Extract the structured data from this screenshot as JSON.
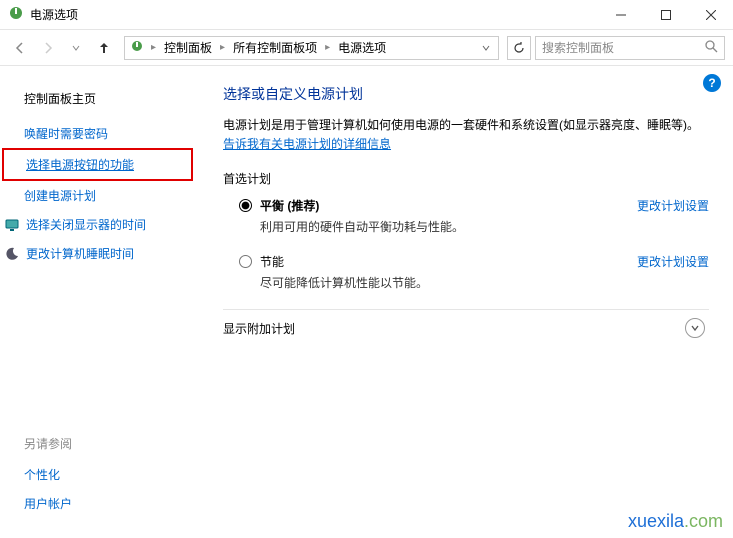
{
  "window": {
    "title": "电源选项"
  },
  "breadcrumb": {
    "items": [
      "控制面板",
      "所有控制面板项",
      "电源选项"
    ]
  },
  "search": {
    "placeholder": "搜索控制面板"
  },
  "sidebar": {
    "home": "控制面板主页",
    "links": [
      {
        "label": "唤醒时需要密码"
      },
      {
        "label": "选择电源按钮的功能",
        "highlighted": true
      },
      {
        "label": "创建电源计划"
      },
      {
        "label": "选择关闭显示器的时间",
        "icon": "monitor"
      },
      {
        "label": "更改计算机睡眠时间",
        "icon": "moon"
      }
    ],
    "seealso_label": "另请参阅",
    "seealso": [
      "个性化",
      "用户帐户"
    ]
  },
  "main": {
    "heading": "选择或自定义电源计划",
    "desc_a": "电源计划是用于管理计算机如何使用电源的一套硬件和系统设置(如显示器亮度、睡眠等)。",
    "desc_link": "告诉我有关电源计划的详细信息",
    "preferred_label": "首选计划",
    "plans": [
      {
        "name": "平衡 (推荐)",
        "sub": "利用可用的硬件自动平衡功耗与性能。",
        "checked": true,
        "change": "更改计划设置"
      },
      {
        "name": "节能",
        "sub": "尽可能降低计算机性能以节能。",
        "checked": false,
        "change": "更改计划设置"
      }
    ],
    "extra_label": "显示附加计划"
  },
  "watermark": {
    "a": "xuexila",
    "b": ".com"
  }
}
